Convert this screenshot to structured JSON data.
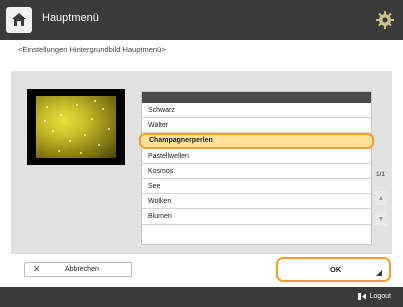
{
  "header": {
    "title": "Hauptmenü",
    "home_icon": "home-icon",
    "gear_icon": "gear-icon"
  },
  "subtitle": "<Einstellungen Hintergrundbild Hauptmenü>",
  "wallpaper_list": {
    "items": [
      "Schwarz",
      "Wälter",
      "Champagnerperlen",
      "Pastellwellen",
      "Kosmos",
      "See",
      "Wolken",
      "Blumen"
    ],
    "selected": "Champagnerperlen",
    "page_indicator": "1/1"
  },
  "buttons": {
    "cancel_label": "Abbrechen",
    "ok_label": "OK"
  },
  "footer": {
    "logout_label": "Logout"
  },
  "colors": {
    "accent": "#f0a030",
    "selected_bg": "#ffe39a",
    "topbar": "#3b3b3b"
  }
}
